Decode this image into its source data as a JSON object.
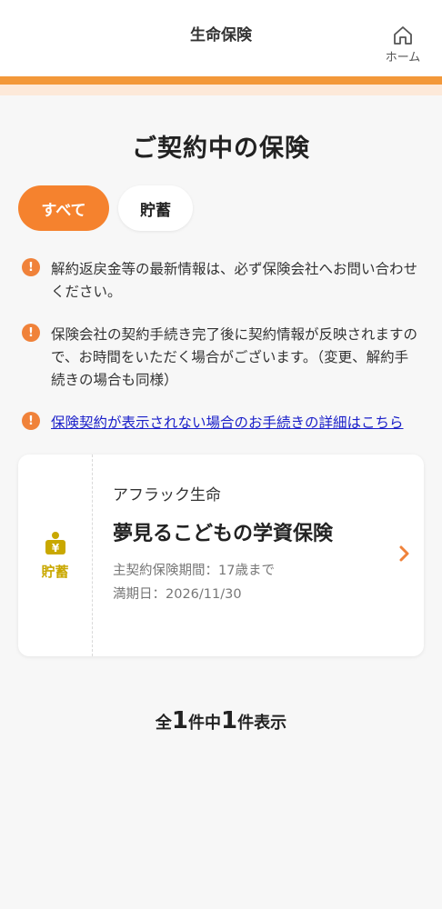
{
  "header": {
    "title": "生命保険",
    "home_label": "ホーム"
  },
  "page": {
    "title": "ご契約中の保険"
  },
  "tabs": [
    {
      "label": "すべて",
      "active": true
    },
    {
      "label": "貯蓄",
      "active": false
    }
  ],
  "notices": [
    {
      "text": "解約返戻金等の最新情報は、必ず保険会社へお問い合わせください。"
    },
    {
      "text": "保険会社の契約手続き完了後に契約情報が反映されますので、お時間をいただく場合がございます。（変更、解約手続きの場合も同様）"
    },
    {
      "link": "保険契約が表示されない場合のお手続きの詳細はこちら"
    }
  ],
  "contract_card": {
    "category": "貯蓄",
    "company": "アフラック生命",
    "product": "夢見るこどもの学資保険",
    "period": "主契約保険期間：17歳まで",
    "maturity": "満期日：2026/11/30"
  },
  "summary": {
    "prefix": "全",
    "total": "1",
    "middle": "件中",
    "shown": "1",
    "suffix": "件表示"
  },
  "colors": {
    "accent": "#f5822e",
    "accent_bar": "#f39839",
    "savings": "#c9a800",
    "link": "#1a1fc9"
  },
  "icons": {
    "home": "home-icon",
    "notice": "exclamation-circle-icon",
    "savings": "yen-piggy-icon",
    "chevron": "chevron-right-icon"
  }
}
